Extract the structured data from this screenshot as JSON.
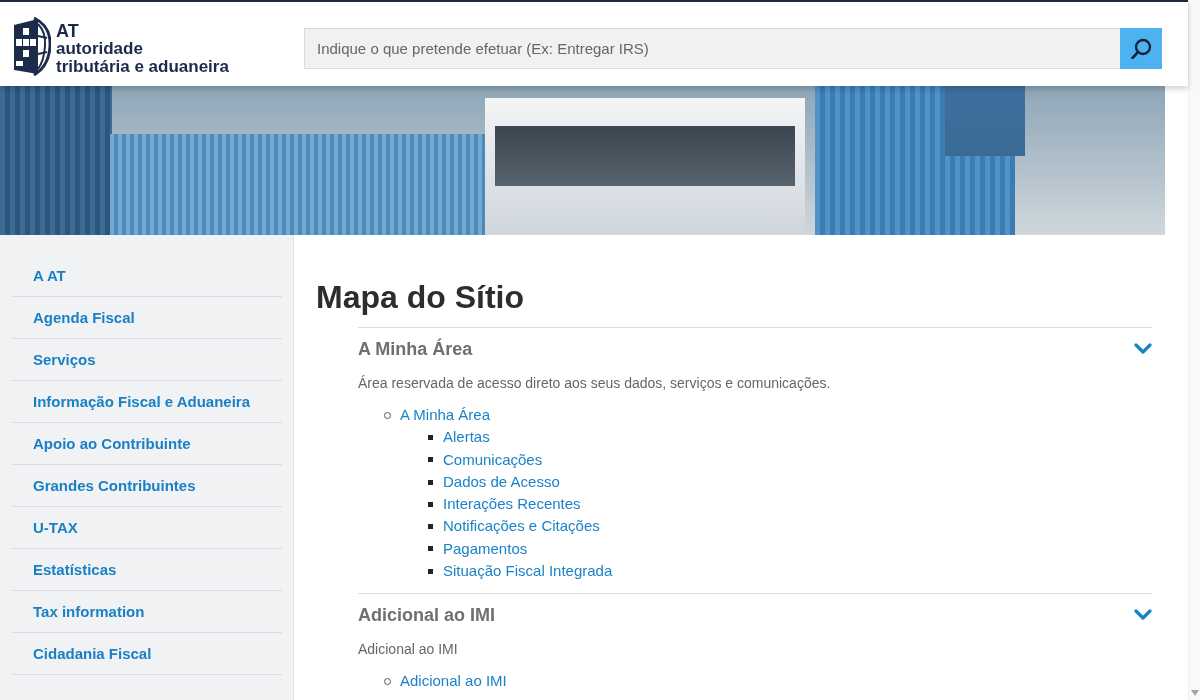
{
  "header": {
    "logo": {
      "abbreviation": "AT",
      "name_lines": [
        "autoridade",
        "tributária e aduaneira"
      ]
    },
    "search": {
      "placeholder": "Indique o que pretende efetuar (Ex: Entregar IRS)"
    }
  },
  "sidebar": {
    "items": [
      "A AT",
      "Agenda Fiscal",
      "Serviços",
      "Informação Fiscal e Aduaneira",
      "Apoio ao Contribuinte",
      "Grandes Contribuintes",
      "U-TAX",
      "Estatísticas",
      "Tax information",
      "Cidadania Fiscal"
    ]
  },
  "title": "Mapa do Sítio",
  "sections": [
    {
      "title": "A Minha Área",
      "expanded": true,
      "description": "Área reservada de acesso direto aos seus dados, serviços e comunicações.",
      "links": [
        {
          "label": "A Minha Área",
          "children": [
            {
              "label": "Alertas"
            },
            {
              "label": "Comunicações"
            },
            {
              "label": "Dados de Acesso"
            },
            {
              "label": "Interações Recentes"
            },
            {
              "label": "Notificações e Citações"
            },
            {
              "label": "Pagamentos"
            },
            {
              "label": "Situação Fiscal Integrada"
            }
          ]
        }
      ]
    },
    {
      "title": "Adicional ao IMI",
      "expanded": true,
      "description": "Adicional ao IMI",
      "links": [
        {
          "label": "Adicional ao IMI"
        }
      ]
    }
  ]
}
